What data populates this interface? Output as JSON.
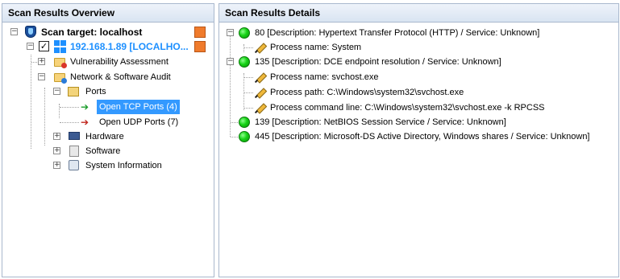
{
  "left_panel": {
    "title": "Scan Results Overview",
    "tree": {
      "scan_target": "Scan target: localhost",
      "host": "192.168.1.89 [LOCALHO...",
      "vuln": "Vulnerability Assessment",
      "network": "Network & Software Audit",
      "ports": "Ports",
      "tcp": "Open TCP Ports (4)",
      "udp": "Open UDP Ports (7)",
      "hardware": "Hardware",
      "software": "Software",
      "sysinfo": "System Information"
    }
  },
  "right_panel": {
    "title": "Scan Results Details",
    "entries": [
      {
        "port": "80 [Description: Hypertext Transfer Protocol (HTTP) / Service: Unknown]",
        "children": [
          "Process name: System"
        ]
      },
      {
        "port": "135 [Description: DCE endpoint resolution / Service: Unknown]",
        "children": [
          "Process name: svchost.exe",
          "Process path: C:\\Windows\\system32\\svchost.exe",
          "Process command line: C:\\Windows\\system32\\svchost.exe -k RPCSS"
        ]
      },
      {
        "port": "139 [Description: NetBIOS Session Service / Service: Unknown]",
        "children": []
      },
      {
        "port": "445 [Description: Microsoft-DS Active Directory, Windows shares / Service: Unknown]",
        "children": []
      }
    ]
  },
  "icons": {
    "scan_target": "shield-icon",
    "host": "windows-icon",
    "status": "green-status-icon",
    "detail": "pencil-icon"
  },
  "colors": {
    "selection": "#3399ff",
    "host_text": "#1e90ff",
    "status_green": "#16d316",
    "action_orange": "#f07b2c"
  }
}
